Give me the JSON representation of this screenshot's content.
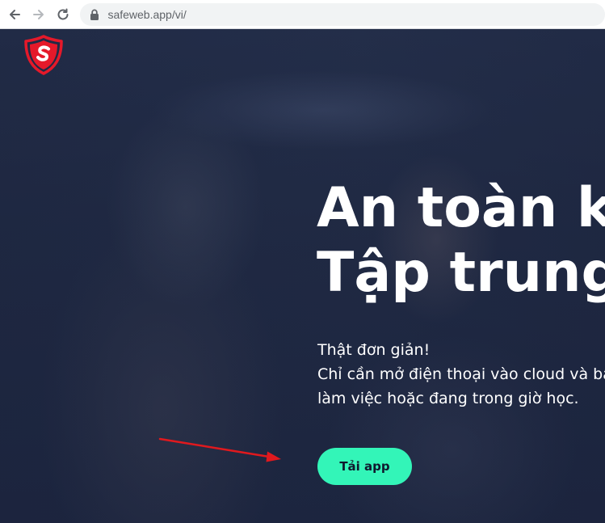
{
  "browser": {
    "url": "safeweb.app/vi/",
    "icons": [
      "back-arrow-icon",
      "forward-arrow-icon",
      "reload-icon",
      "lock-icon"
    ]
  },
  "hero": {
    "logo_icon": "shield-s-logo",
    "logo_color": "#e5192a",
    "headline_line1": "An toàn kh",
    "headline_line2": "Tập trung",
    "subtext_line1": "Thật đơn giản!",
    "subtext_line2": "Chỉ cần mở điện thoại vào cloud và bật che",
    "subtext_line3": "làm việc hoặc đang trong giờ học.",
    "cta_label": "Tải app",
    "cta_color": "#33f5b8",
    "annotation": {
      "type": "red-arrow",
      "color": "#e0191e"
    }
  }
}
